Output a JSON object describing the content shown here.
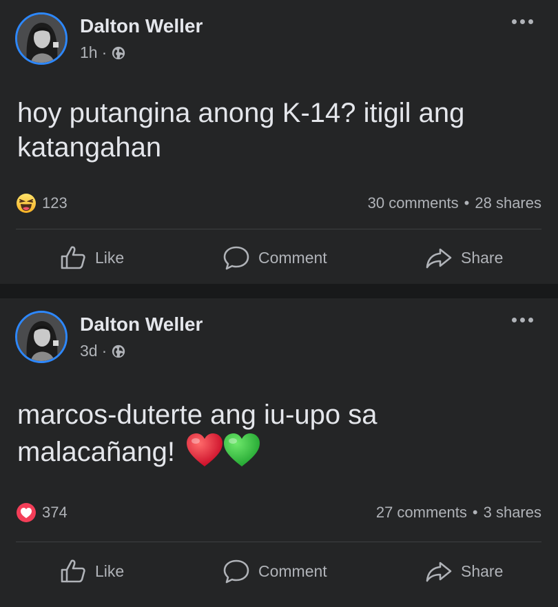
{
  "colors": {
    "background": "#18191a",
    "card": "#242526",
    "text_primary": "#e4e6eb",
    "text_secondary": "#b0b3b8",
    "avatar_ring": "#2d88ff",
    "divider": "#3e4042"
  },
  "posts": [
    {
      "author": "Dalton Weller",
      "time": "1h",
      "separator": "·",
      "privacy_icon": "globe-icon",
      "text": "hoy putangina anong K-14? itigil ang katangahan",
      "reaction_icon": "haha-reaction-icon",
      "reaction_count": "123",
      "comments": "30 comments",
      "stat_separator": "•",
      "shares": "28 shares",
      "actions": {
        "like": "Like",
        "comment": "Comment",
        "share": "Share"
      }
    },
    {
      "author": "Dalton Weller",
      "time": "3d",
      "separator": "·",
      "privacy_icon": "globe-icon",
      "text": "marcos-duterte ang iu-upo sa malacañang!",
      "emojis": [
        "red-heart-icon",
        "green-heart-icon"
      ],
      "reaction_icon": "love-reaction-icon",
      "reaction_count": "374",
      "comments": "27 comments",
      "stat_separator": "•",
      "shares": "3 shares",
      "actions": {
        "like": "Like",
        "comment": "Comment",
        "share": "Share"
      }
    }
  ]
}
